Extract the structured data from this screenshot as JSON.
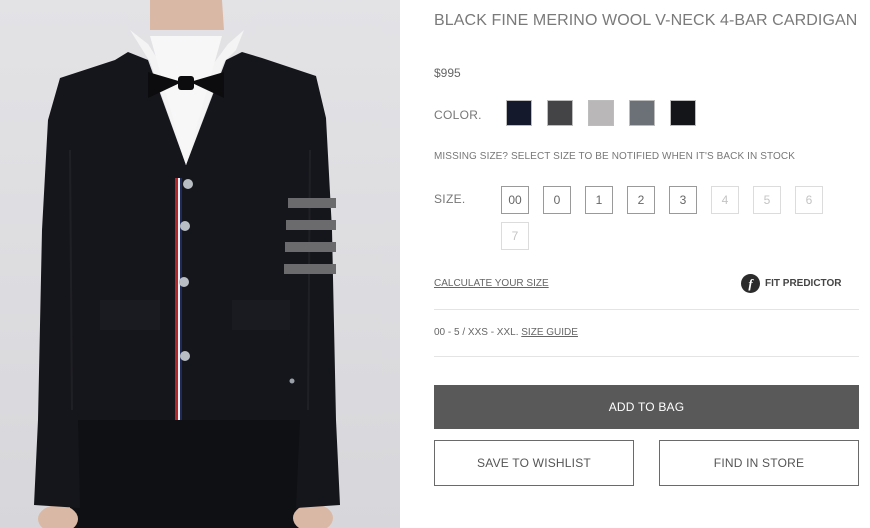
{
  "product": {
    "title": "BLACK FINE MERINO WOOL V-NECK 4-BAR CARDIGAN",
    "price": "$995"
  },
  "color": {
    "label": "COLOR.",
    "swatches": [
      {
        "name": "navy",
        "hex": "#141a2b"
      },
      {
        "name": "dark-grey",
        "hex": "#444446"
      },
      {
        "name": "light-grey",
        "hex": "#b9b7b8"
      },
      {
        "name": "medium-grey",
        "hex": "#6c7077"
      },
      {
        "name": "black",
        "hex": "#141518"
      }
    ]
  },
  "notice": "MISSING SIZE? SELECT SIZE TO BE NOTIFIED WHEN IT'S BACK IN STOCK",
  "size": {
    "label": "SIZE.",
    "options": [
      {
        "label": "00",
        "available": true
      },
      {
        "label": "0",
        "available": true
      },
      {
        "label": "1",
        "available": true
      },
      {
        "label": "2",
        "available": true
      },
      {
        "label": "3",
        "available": true
      },
      {
        "label": "4",
        "available": false
      },
      {
        "label": "5",
        "available": false
      },
      {
        "label": "6",
        "available": false
      },
      {
        "label": "7",
        "available": false
      }
    ]
  },
  "links": {
    "calculate": "CALCULATE YOUR SIZE",
    "fit_icon": "f",
    "fit_predictor": "FIT PREDICTOR"
  },
  "range": {
    "text": "00 - 5 / XXS - XXL.",
    "guide": "SIZE GUIDE"
  },
  "buttons": {
    "add_to_bag": "ADD TO BAG",
    "wishlist": "SAVE TO WISHLIST",
    "find_in_store": "FIND IN STORE"
  },
  "colors": {
    "primary_button": "#595959",
    "stripe_grey": "#6b6b6e",
    "placket_red": "#b3262b",
    "placket_navy": "#1d2a5a"
  }
}
